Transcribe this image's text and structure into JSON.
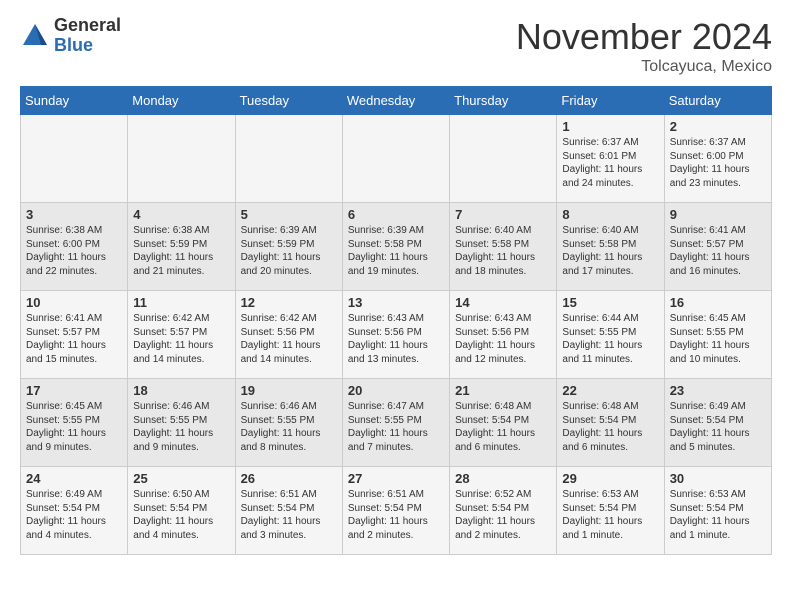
{
  "header": {
    "logo_general": "General",
    "logo_blue": "Blue",
    "month": "November 2024",
    "location": "Tolcayuca, Mexico"
  },
  "days_of_week": [
    "Sunday",
    "Monday",
    "Tuesday",
    "Wednesday",
    "Thursday",
    "Friday",
    "Saturday"
  ],
  "weeks": [
    [
      {
        "day": "",
        "info": ""
      },
      {
        "day": "",
        "info": ""
      },
      {
        "day": "",
        "info": ""
      },
      {
        "day": "",
        "info": ""
      },
      {
        "day": "",
        "info": ""
      },
      {
        "day": "1",
        "info": "Sunrise: 6:37 AM\nSunset: 6:01 PM\nDaylight: 11 hours and 24 minutes."
      },
      {
        "day": "2",
        "info": "Sunrise: 6:37 AM\nSunset: 6:00 PM\nDaylight: 11 hours and 23 minutes."
      }
    ],
    [
      {
        "day": "3",
        "info": "Sunrise: 6:38 AM\nSunset: 6:00 PM\nDaylight: 11 hours and 22 minutes."
      },
      {
        "day": "4",
        "info": "Sunrise: 6:38 AM\nSunset: 5:59 PM\nDaylight: 11 hours and 21 minutes."
      },
      {
        "day": "5",
        "info": "Sunrise: 6:39 AM\nSunset: 5:59 PM\nDaylight: 11 hours and 20 minutes."
      },
      {
        "day": "6",
        "info": "Sunrise: 6:39 AM\nSunset: 5:58 PM\nDaylight: 11 hours and 19 minutes."
      },
      {
        "day": "7",
        "info": "Sunrise: 6:40 AM\nSunset: 5:58 PM\nDaylight: 11 hours and 18 minutes."
      },
      {
        "day": "8",
        "info": "Sunrise: 6:40 AM\nSunset: 5:58 PM\nDaylight: 11 hours and 17 minutes."
      },
      {
        "day": "9",
        "info": "Sunrise: 6:41 AM\nSunset: 5:57 PM\nDaylight: 11 hours and 16 minutes."
      }
    ],
    [
      {
        "day": "10",
        "info": "Sunrise: 6:41 AM\nSunset: 5:57 PM\nDaylight: 11 hours and 15 minutes."
      },
      {
        "day": "11",
        "info": "Sunrise: 6:42 AM\nSunset: 5:57 PM\nDaylight: 11 hours and 14 minutes."
      },
      {
        "day": "12",
        "info": "Sunrise: 6:42 AM\nSunset: 5:56 PM\nDaylight: 11 hours and 14 minutes."
      },
      {
        "day": "13",
        "info": "Sunrise: 6:43 AM\nSunset: 5:56 PM\nDaylight: 11 hours and 13 minutes."
      },
      {
        "day": "14",
        "info": "Sunrise: 6:43 AM\nSunset: 5:56 PM\nDaylight: 11 hours and 12 minutes."
      },
      {
        "day": "15",
        "info": "Sunrise: 6:44 AM\nSunset: 5:55 PM\nDaylight: 11 hours and 11 minutes."
      },
      {
        "day": "16",
        "info": "Sunrise: 6:45 AM\nSunset: 5:55 PM\nDaylight: 11 hours and 10 minutes."
      }
    ],
    [
      {
        "day": "17",
        "info": "Sunrise: 6:45 AM\nSunset: 5:55 PM\nDaylight: 11 hours and 9 minutes."
      },
      {
        "day": "18",
        "info": "Sunrise: 6:46 AM\nSunset: 5:55 PM\nDaylight: 11 hours and 9 minutes."
      },
      {
        "day": "19",
        "info": "Sunrise: 6:46 AM\nSunset: 5:55 PM\nDaylight: 11 hours and 8 minutes."
      },
      {
        "day": "20",
        "info": "Sunrise: 6:47 AM\nSunset: 5:55 PM\nDaylight: 11 hours and 7 minutes."
      },
      {
        "day": "21",
        "info": "Sunrise: 6:48 AM\nSunset: 5:54 PM\nDaylight: 11 hours and 6 minutes."
      },
      {
        "day": "22",
        "info": "Sunrise: 6:48 AM\nSunset: 5:54 PM\nDaylight: 11 hours and 6 minutes."
      },
      {
        "day": "23",
        "info": "Sunrise: 6:49 AM\nSunset: 5:54 PM\nDaylight: 11 hours and 5 minutes."
      }
    ],
    [
      {
        "day": "24",
        "info": "Sunrise: 6:49 AM\nSunset: 5:54 PM\nDaylight: 11 hours and 4 minutes."
      },
      {
        "day": "25",
        "info": "Sunrise: 6:50 AM\nSunset: 5:54 PM\nDaylight: 11 hours and 4 minutes."
      },
      {
        "day": "26",
        "info": "Sunrise: 6:51 AM\nSunset: 5:54 PM\nDaylight: 11 hours and 3 minutes."
      },
      {
        "day": "27",
        "info": "Sunrise: 6:51 AM\nSunset: 5:54 PM\nDaylight: 11 hours and 2 minutes."
      },
      {
        "day": "28",
        "info": "Sunrise: 6:52 AM\nSunset: 5:54 PM\nDaylight: 11 hours and 2 minutes."
      },
      {
        "day": "29",
        "info": "Sunrise: 6:53 AM\nSunset: 5:54 PM\nDaylight: 11 hours and 1 minute."
      },
      {
        "day": "30",
        "info": "Sunrise: 6:53 AM\nSunset: 5:54 PM\nDaylight: 11 hours and 1 minute."
      }
    ]
  ]
}
